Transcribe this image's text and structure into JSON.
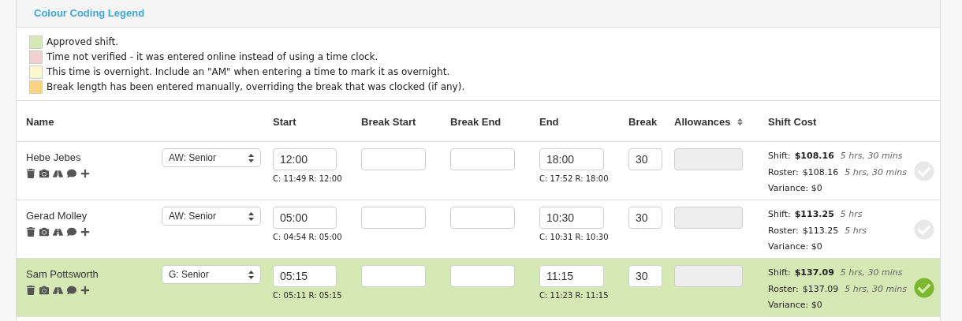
{
  "legend": {
    "title": "Colour Coding Legend",
    "items": [
      {
        "label": "Approved shift.",
        "color": "#d6e9b4"
      },
      {
        "label": "Time not verified - it was entered online instead of using a time clock.",
        "color": "#f2cfd0"
      },
      {
        "label": "This time is overnight. Include an \"AM\" when entering a time to mark it as overnight.",
        "color": "#fdf7cf"
      },
      {
        "label": "Break length has been entered manually, overriding the break that was clocked (if any).",
        "color": "#fdd383"
      }
    ]
  },
  "table": {
    "columns": [
      {
        "label": "Name",
        "sortable": false
      },
      {
        "label": "Start",
        "sortable": false
      },
      {
        "label": "Break Start",
        "sortable": false
      },
      {
        "label": "Break End",
        "sortable": false
      },
      {
        "label": "End",
        "sortable": false
      },
      {
        "label": "Break",
        "sortable": false
      },
      {
        "label": "Allowances",
        "sortable": true
      },
      {
        "label": "Shift Cost",
        "sortable": false
      }
    ],
    "rows": [
      {
        "name": "Hebe Jebes",
        "role": "AW: Senior",
        "start": "12:00",
        "start_note": "C: 11:49 R: 12:00",
        "break_start": "",
        "break_end": "",
        "end": "18:00",
        "end_note": "C: 17:52 R: 18:00",
        "break": "30",
        "shift_label": "Shift:",
        "shift": "$108.16",
        "shift_hours": "5 hrs, 30 mins",
        "roster_label": "Roster:",
        "roster": "$108.16",
        "roster_hours": "5 hrs, 30 mins",
        "variance": "Variance: $0",
        "approved": false
      },
      {
        "name": "Gerad Molley",
        "role": "AW: Senior",
        "start": "05:00",
        "start_note": "C: 04:54 R: 05:00",
        "break_start": "",
        "break_end": "",
        "end": "10:30",
        "end_note": "C: 10:31 R: 10:30",
        "break": "30",
        "shift_label": "Shift:",
        "shift": "$113.25",
        "shift_hours": "5 hrs",
        "roster_label": "Roster:",
        "roster": "$113.25",
        "roster_hours": "5 hrs",
        "variance": "Variance: $0",
        "approved": false
      },
      {
        "name": "Sam Pottsworth",
        "role": "G: Senior",
        "start": "05:15",
        "start_note": "C: 05:11 R: 05:15",
        "break_start": "",
        "break_end": "",
        "end": "11:15",
        "end_note": "C: 11:23 R: 11:15",
        "break": "30",
        "shift_label": "Shift:",
        "shift": "$137.09",
        "shift_hours": "5 hrs, 30 mins",
        "roster_label": "Roster:",
        "roster": "$137.09",
        "roster_hours": "5 hrs, 30 mins",
        "variance": "Variance: $0",
        "approved": true
      }
    ]
  }
}
